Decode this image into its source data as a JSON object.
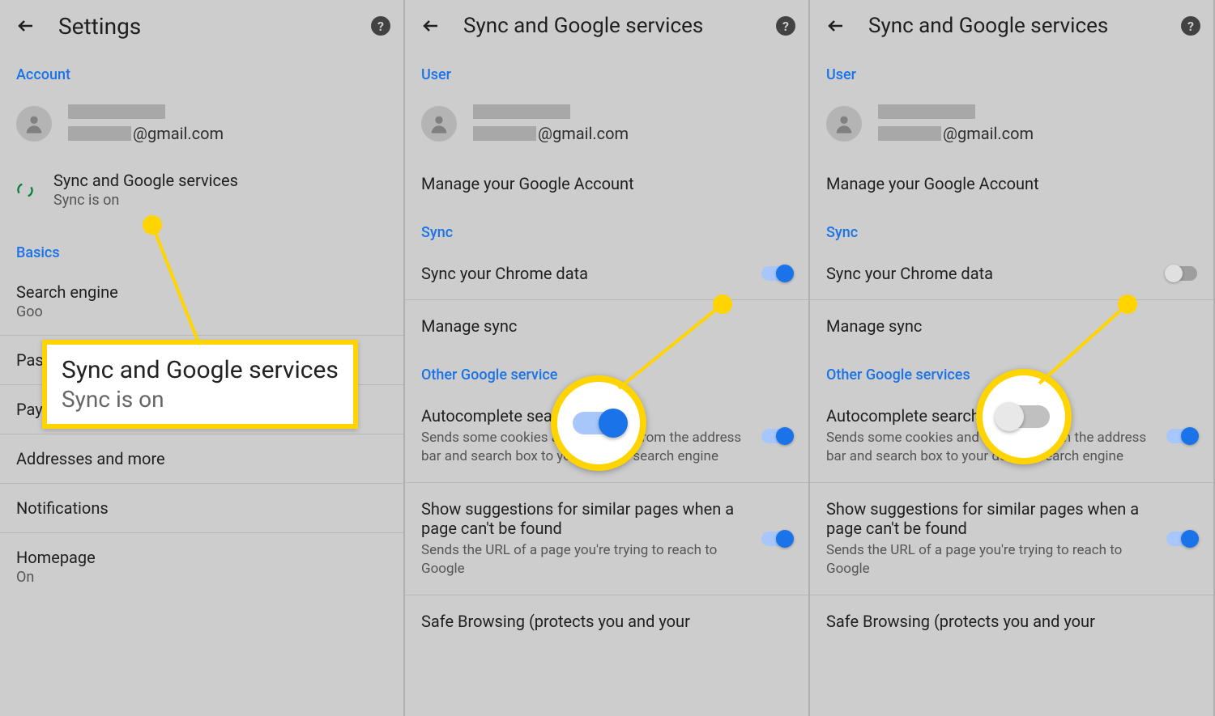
{
  "panel1": {
    "title": "Settings",
    "sections": {
      "account": "Account",
      "basics": "Basics"
    },
    "profile": {
      "email_domain": "@gmail.com"
    },
    "sync_item": {
      "title": "Sync and Google services",
      "sub": "Sync is on"
    },
    "callout": {
      "title": "Sync and Google services",
      "sub": "Sync is on"
    },
    "rows": {
      "search": {
        "title": "Search engine",
        "sub": "Goo"
      },
      "pass": "Pas",
      "payment": "Payment methods",
      "addresses": "Addresses and more",
      "notifications": "Notifications",
      "homepage": {
        "title": "Homepage",
        "sub": "On"
      }
    }
  },
  "panel2": {
    "title": "Sync and Google services",
    "sections": {
      "user": "User",
      "sync": "Sync",
      "other": "Other Google service"
    },
    "profile": {
      "email_domain": "@gmail.com"
    },
    "manage_account": "Manage your Google Account",
    "sync_data": "Sync your Chrome data",
    "manage_sync": "Manage sync",
    "auto_title": "Autocomplete searc          URLs",
    "auto_desc": "Sends some cookies and searches from the address bar and search box to your default search engine",
    "sugg_title": "Show suggestions for similar pages when a page can't be found",
    "sugg_desc": "Sends the URL of a page you're trying to reach to Google",
    "safe_title": "Safe Browsing (protects you and your"
  },
  "panel3": {
    "title": "Sync and Google services",
    "sections": {
      "user": "User",
      "sync": "Sync",
      "other": "Other Google services"
    },
    "profile": {
      "email_domain": "@gmail.com"
    },
    "manage_account": "Manage your Google Account",
    "sync_data": "Sync your Chrome data",
    "manage_sync": "Manage sync",
    "auto_title": "Autocomplete searches           Ls",
    "auto_desc": "Sends some cookies and searches from the address bar and search box to your default search engine",
    "sugg_title": "Show suggestions for similar pages when a page can't be found",
    "sugg_desc": "Sends the URL of a page you're trying to reach to Google",
    "safe_title": "Safe Browsing (protects you and your"
  }
}
